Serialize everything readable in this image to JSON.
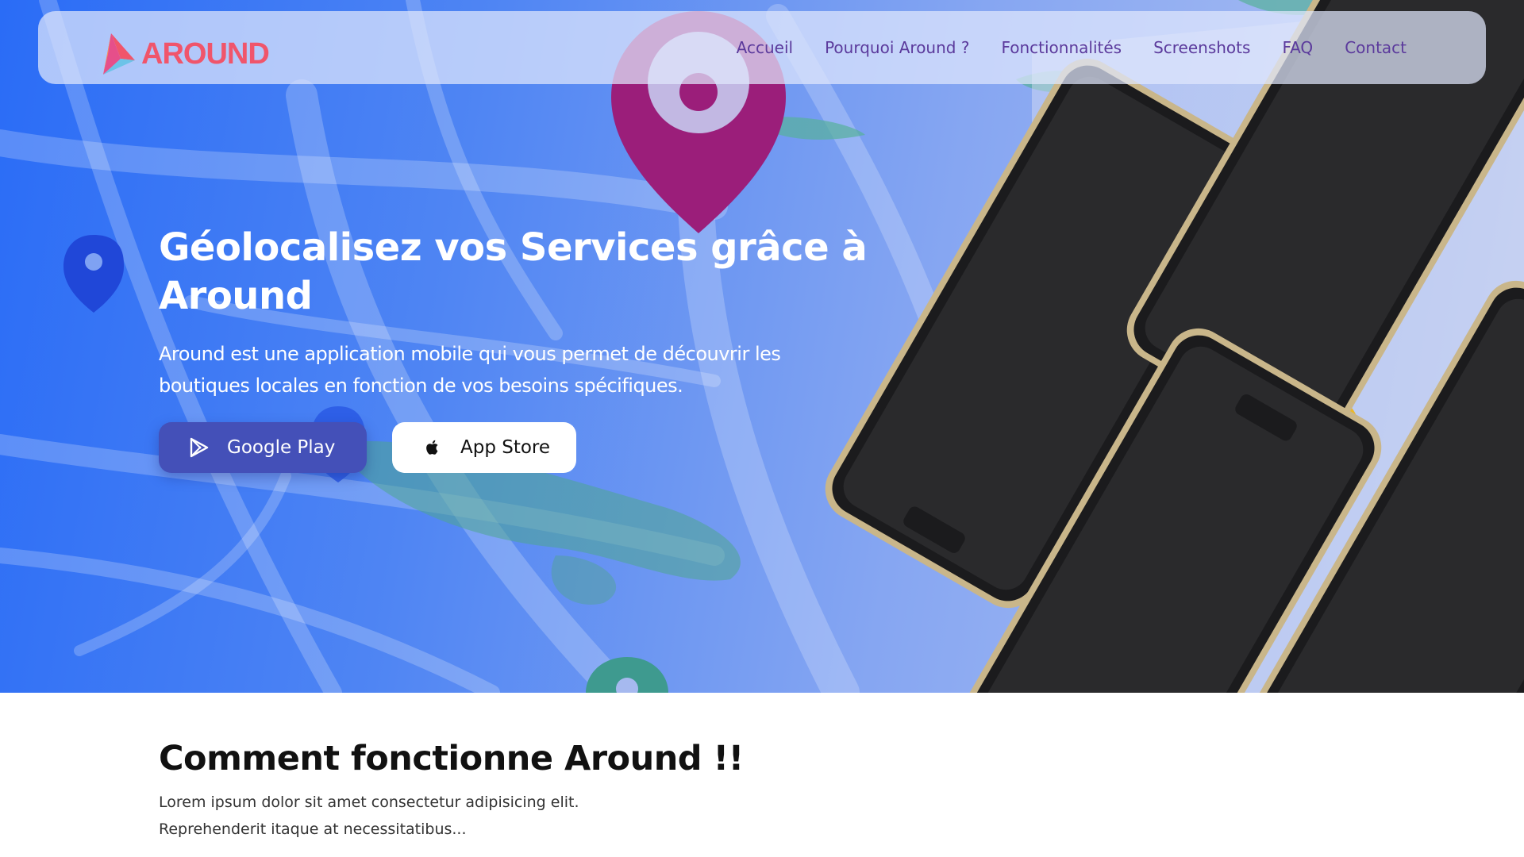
{
  "brand": {
    "name": "AROUND",
    "color": "#f0556b"
  },
  "nav": {
    "items": [
      {
        "label": "Accueil"
      },
      {
        "label": "Pourquoi Around ?"
      },
      {
        "label": "Fonctionnalités"
      },
      {
        "label": "Screenshots"
      },
      {
        "label": "FAQ"
      },
      {
        "label": "Contact"
      }
    ],
    "color": "#5b3a9c"
  },
  "hero": {
    "title": "Géolocalisez vos Services grâce à Around",
    "description": "Around est une application mobile qui vous permet de découvrir les boutiques locales en fonction de vos besoins spécifiques.",
    "buttons": {
      "google_play": "Google Play",
      "app_store": "App Store"
    },
    "colors": {
      "gradient_start": "#2a6cf6",
      "gradient_end": "#b9c8f1",
      "google_button": "#4450b8"
    }
  },
  "section": {
    "title": "Comment fonctionne Around !!",
    "text": "Lorem ipsum dolor sit amet consectetur adipisicing elit. Reprehenderit itaque at necessitatibus..."
  },
  "icons": {
    "logo": "around-logo-icon",
    "google_play": "play-store-icon",
    "app_store": "apple-icon",
    "map_pins": "map-pin-icon"
  }
}
